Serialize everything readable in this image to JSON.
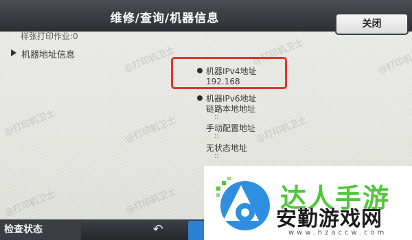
{
  "title": "维修/查询/机器信息",
  "close_label": "关闭",
  "watermark": "@打印机卫士",
  "items": {
    "sample_print": "样张打印作业:0",
    "machine_address": "机器地址信息",
    "ipv4_label": "机器IPv4地址",
    "ipv4_value": "192.168",
    "ipv6_label": "机器IPv6地址",
    "link_local_label": "链路本地地址",
    "link_local_value": "::",
    "manual_label": "手动配置地址",
    "manual_value": "::",
    "stateless_label": "无状态地址",
    "stateless_value": "::"
  },
  "bottom": {
    "status_label": "检查状态",
    "back_symbol": "↶"
  },
  "logo": {
    "top_text": "达人手游",
    "main_text": "安勤游戏网",
    "url_text": "www.hzaccw.com"
  },
  "colors": {
    "highlight": "#e0352b",
    "title_bar": "#2c2f33",
    "accent_blue": "#2d7fd4",
    "logo_green": "#4fc73a"
  }
}
